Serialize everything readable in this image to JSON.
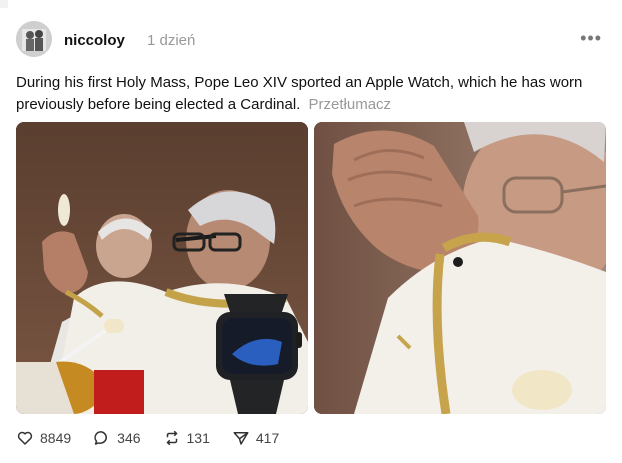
{
  "post": {
    "username": "niccoloy",
    "time": "1 dzień",
    "text": "During his first Holy Mass, Pope Leo XIV sported an Apple Watch, which he has worn previously before being elected a Cardinal.",
    "translate_label": "Przetłumacz"
  },
  "actions": {
    "likes": "8849",
    "comments": "346",
    "reposts": "131",
    "shares": "417"
  },
  "icons": {
    "more": "more-options-icon",
    "like": "heart-icon",
    "comment": "comment-bubble-icon",
    "repost": "repost-icon",
    "share": "send-icon"
  }
}
